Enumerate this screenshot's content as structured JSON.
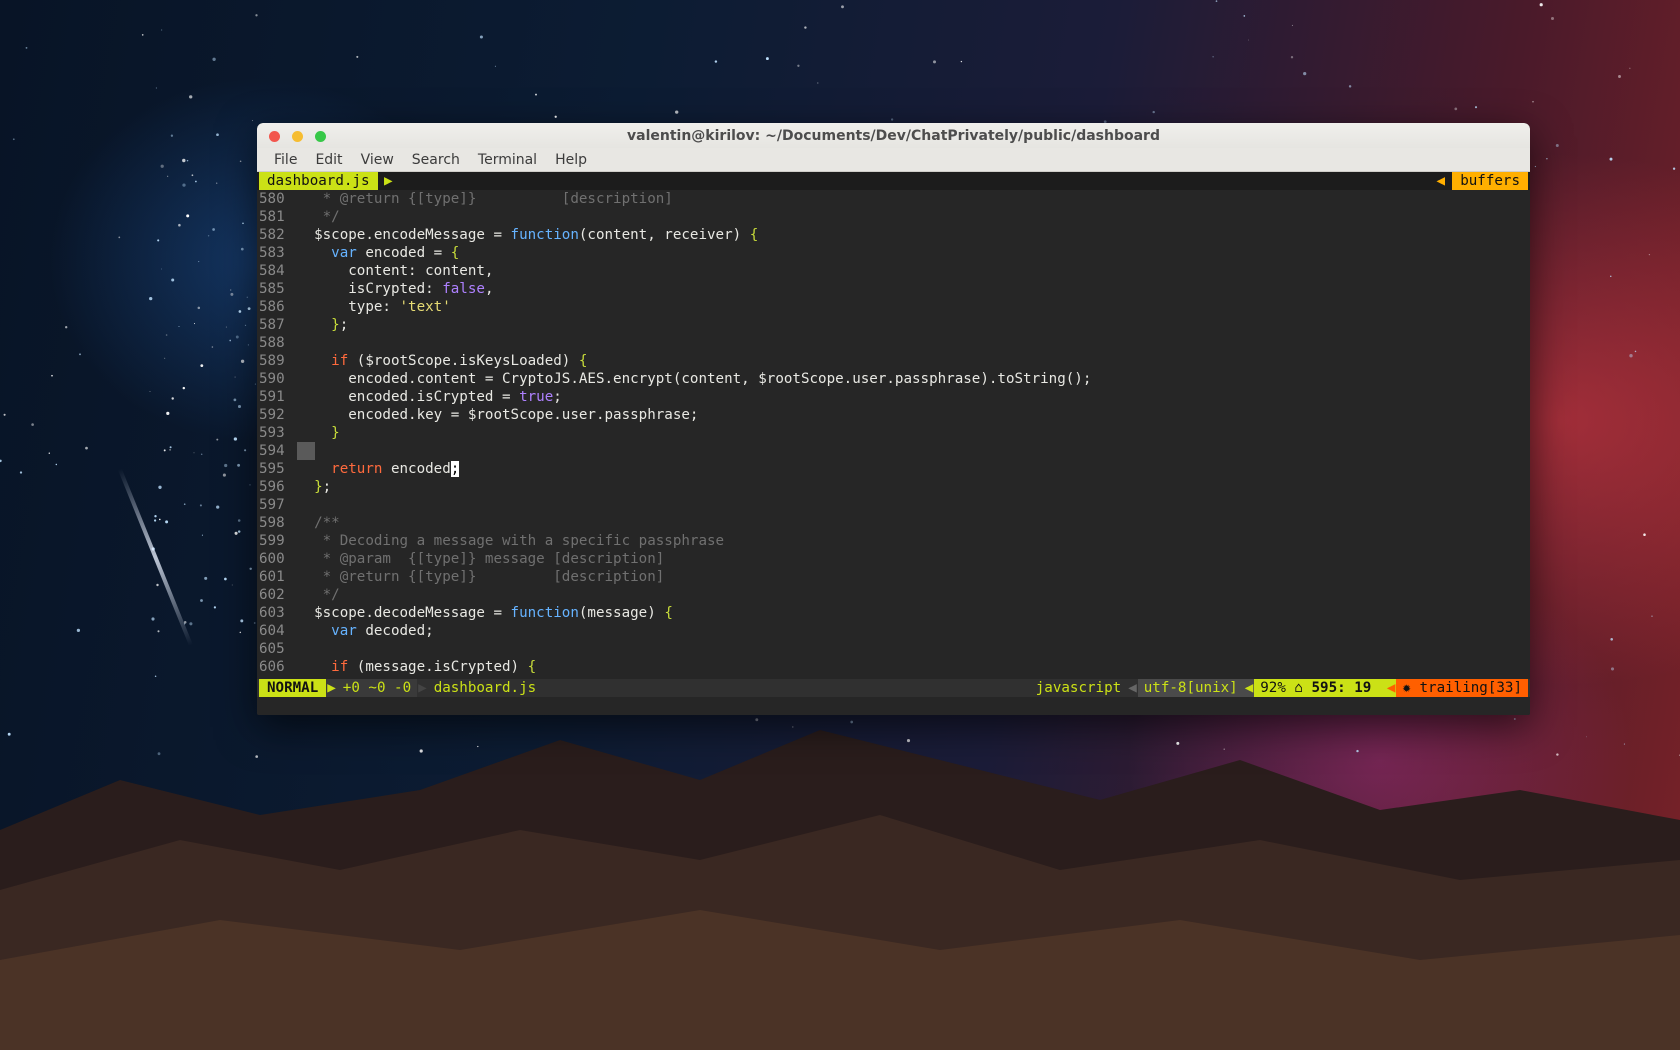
{
  "window": {
    "title": "valentin@kirilov: ~/Documents/Dev/ChatPrivately/public/dashboard",
    "menu": [
      "File",
      "Edit",
      "View",
      "Search",
      "Terminal",
      "Help"
    ]
  },
  "tabline": {
    "active_tab": "dashboard.js",
    "buffers_label": "buffers"
  },
  "code_lines": [
    {
      "n": "580",
      "segments": [
        [
          "cm",
          "   * @return {[type]}          [description]"
        ]
      ]
    },
    {
      "n": "581",
      "segments": [
        [
          "cm",
          "   */"
        ]
      ]
    },
    {
      "n": "582",
      "segments": [
        [
          "",
          "  $scope.encodeMessage = "
        ],
        [
          "fn",
          "function"
        ],
        [
          "",
          "(content, receiver) "
        ],
        [
          "br",
          "{"
        ]
      ]
    },
    {
      "n": "583",
      "segments": [
        [
          "",
          "    "
        ],
        [
          "fn",
          "var"
        ],
        [
          "",
          " encoded = "
        ],
        [
          "br",
          "{"
        ]
      ]
    },
    {
      "n": "584",
      "segments": [
        [
          "",
          "      content: content,"
        ]
      ]
    },
    {
      "n": "585",
      "segments": [
        [
          "",
          "      isCrypted: "
        ],
        [
          "bool",
          "false"
        ],
        [
          "",
          ","
        ]
      ]
    },
    {
      "n": "586",
      "segments": [
        [
          "",
          "      type: "
        ],
        [
          "str",
          "'text'"
        ]
      ]
    },
    {
      "n": "587",
      "segments": [
        [
          "",
          "    "
        ],
        [
          "br",
          "}"
        ],
        [
          "",
          ";"
        ]
      ]
    },
    {
      "n": "588",
      "segments": []
    },
    {
      "n": "589",
      "segments": [
        [
          "",
          "    "
        ],
        [
          "kw",
          "if"
        ],
        [
          "",
          " ($rootScope.isKeysLoaded) "
        ],
        [
          "br",
          "{"
        ]
      ]
    },
    {
      "n": "590",
      "segments": [
        [
          "",
          "      encoded.content = CryptoJS.AES.encrypt(content, $rootScope.user.passphrase).toString();"
        ]
      ]
    },
    {
      "n": "591",
      "segments": [
        [
          "",
          "      encoded.isCrypted = "
        ],
        [
          "bool",
          "true"
        ],
        [
          "",
          ";"
        ]
      ]
    },
    {
      "n": "592",
      "segments": [
        [
          "",
          "      encoded.key = $rootScope.user.passphrase;"
        ]
      ]
    },
    {
      "n": "593",
      "segments": [
        [
          "",
          "    "
        ],
        [
          "br",
          "}"
        ]
      ]
    },
    {
      "n": "594",
      "segments": [],
      "marker": true
    },
    {
      "n": "595",
      "segments": [
        [
          "",
          "    "
        ],
        [
          "kw",
          "return"
        ],
        [
          "",
          " encoded"
        ],
        [
          "cursor",
          ";"
        ]
      ]
    },
    {
      "n": "596",
      "segments": [
        [
          "",
          "  "
        ],
        [
          "br",
          "}"
        ],
        [
          "",
          ";"
        ]
      ]
    },
    {
      "n": "597",
      "segments": []
    },
    {
      "n": "598",
      "segments": [
        [
          "cm",
          "  /**"
        ]
      ]
    },
    {
      "n": "599",
      "segments": [
        [
          "cm",
          "   * Decoding a message with a specific passphrase"
        ]
      ]
    },
    {
      "n": "600",
      "segments": [
        [
          "cm",
          "   * @param  {[type]} message [description]"
        ]
      ]
    },
    {
      "n": "601",
      "segments": [
        [
          "cm",
          "   * @return {[type]}         [description]"
        ]
      ]
    },
    {
      "n": "602",
      "segments": [
        [
          "cm",
          "   */"
        ]
      ]
    },
    {
      "n": "603",
      "segments": [
        [
          "",
          "  $scope.decodeMessage = "
        ],
        [
          "fn",
          "function"
        ],
        [
          "",
          "(message) "
        ],
        [
          "br",
          "{"
        ]
      ]
    },
    {
      "n": "604",
      "segments": [
        [
          "",
          "    "
        ],
        [
          "fn",
          "var"
        ],
        [
          "",
          " decoded;"
        ]
      ]
    },
    {
      "n": "605",
      "segments": []
    },
    {
      "n": "606",
      "segments": [
        [
          "",
          "    "
        ],
        [
          "kw",
          "if"
        ],
        [
          "",
          " (message.isCrypted) "
        ],
        [
          "br",
          "{"
        ]
      ]
    }
  ],
  "statusline": {
    "mode": "NORMAL",
    "git": "+0 ~0 -0",
    "filename": "dashboard.js",
    "filetype": "javascript",
    "encoding": "utf-8[unix]",
    "percent": "92%",
    "position": "595: 19",
    "warning": "trailing[33]"
  },
  "colors": {
    "accent_green": "#cbe116",
    "accent_orange": "#ffaf00",
    "warning_orange": "#ff5f00",
    "terminal_bg": "#262626"
  }
}
